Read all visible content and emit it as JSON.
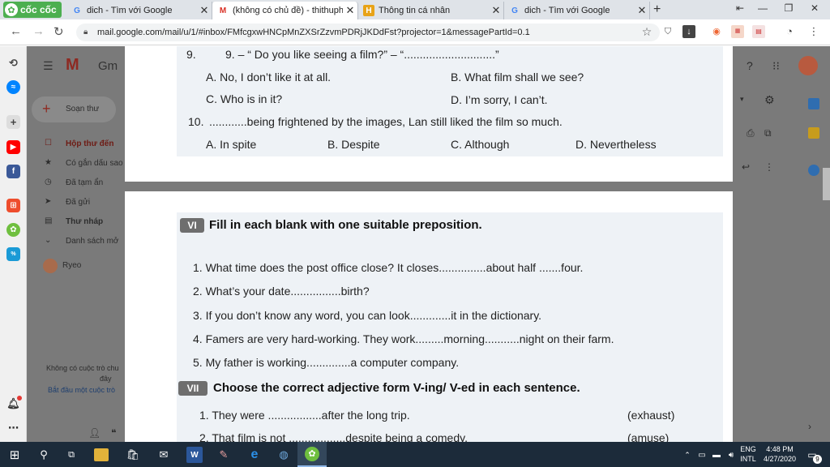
{
  "browser": {
    "logo": "cốc cốc",
    "tabs": [
      {
        "label": "dich - Tìm với Google",
        "favicon": "G"
      },
      {
        "label": "(không có chủ đề) - thithuph",
        "favicon": "M"
      },
      {
        "label": "Thông tin cá nhân",
        "favicon": "H"
      },
      {
        "label": "dich - Tìm với Google",
        "favicon": "G"
      }
    ],
    "new_tab": "+",
    "url": "mail.google.com/mail/u/1/#inbox/FMfcgxwHNCpMnZXSrZzvmPDRjJKDdFst?projector=1&messagePartId=0.1"
  },
  "gmail": {
    "logo_text": "Gm",
    "compose": "Soạn thư",
    "nav": [
      "Hộp thư đến",
      "Có gắn dấu sao",
      "Đã tạm ẩn",
      "Đã gửi",
      "Thư nháp",
      "Danh sách mở"
    ],
    "user": "Ryeo",
    "hangouts_empty_1": "Không có cuộc trò chu",
    "hangouts_empty_2": "đây",
    "hangouts_start": "Bắt đầu một cuộc trò"
  },
  "worksheet_top": {
    "q9_num": "9.",
    "q9": "9. – “ Do you like seeing a film?” – “.............................”",
    "q9_a": "A. No, I don’t like it at all.",
    "q9_b": "B. What film shall we see?",
    "q9_c": "C.  Who is in it?",
    "q9_d": "D. I’m sorry, I can’t.",
    "q10_num": "10.",
    "q10": "............being frightened by the images, Lan still liked the film so much.",
    "q10_a": "A. In spite",
    "q10_b": "B. Despite",
    "q10_c": "C. Although",
    "q10_d": "D. Nevertheless"
  },
  "worksheet_bottom": {
    "sec6_badge": "VI",
    "sec6_title": "Fill in each blank with one suitable preposition.",
    "items6": [
      "1.  What time does the post office close? It closes...............about half .......four.",
      "2.  What’s your date................birth?",
      "3.  If you don’t know any word, you can look.............it in the dictionary.",
      "4.  Famers are very hard-working. They work.........morning...........night on their farm.",
      "5.  My father is working..............a computer company."
    ],
    "sec7_badge": "VII",
    "sec7_title": "Choose the correct adjective form V-ing/ V-ed in each sentence.",
    "item7_1": "1.  They were .................after the long trip.",
    "item7_1_hint": "(exhaust)",
    "item7_2": "2.  That film is not ..................despite being a comedy.",
    "item7_2_hint": "(amuse)"
  },
  "taskbar": {
    "lang_1": "ENG",
    "lang_2": "INTL",
    "time": "4:48 PM",
    "date": "4/27/2020",
    "notif_count": "9"
  }
}
